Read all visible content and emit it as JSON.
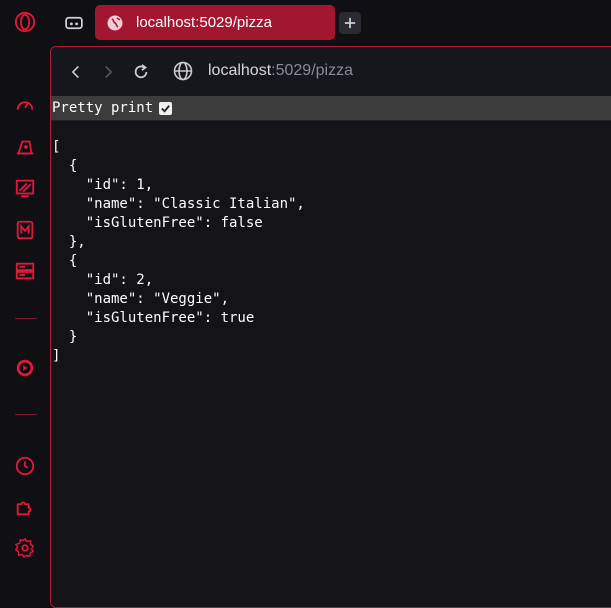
{
  "browser": {
    "tab_title": "localhost:5029/pizza",
    "address_host": "localhost",
    "address_path": ":5029/pizza",
    "accent_color": "#a3162f",
    "icons": [
      "opera-logo-icon",
      "workspace-icon",
      "globe-icon",
      "plus-icon",
      "back-arrow-icon",
      "forward-arrow-icon",
      "reload-icon",
      "speed-dial-icon",
      "aria-icon",
      "gx-icon",
      "m-icon",
      "cards-icon",
      "player-icon",
      "history-icon",
      "extensions-icon",
      "settings-icon"
    ]
  },
  "viewer": {
    "pretty_print_label": "Pretty print",
    "pretty_print_checked": true
  },
  "json_lines": [
    "[",
    "  {",
    "    \"id\": 1,",
    "    \"name\": \"Classic Italian\",",
    "    \"isGlutenFree\": false",
    "  },",
    "  {",
    "    \"id\": 2,",
    "    \"name\": \"Veggie\",",
    "    \"isGlutenFree\": true",
    "  }",
    "]"
  ]
}
